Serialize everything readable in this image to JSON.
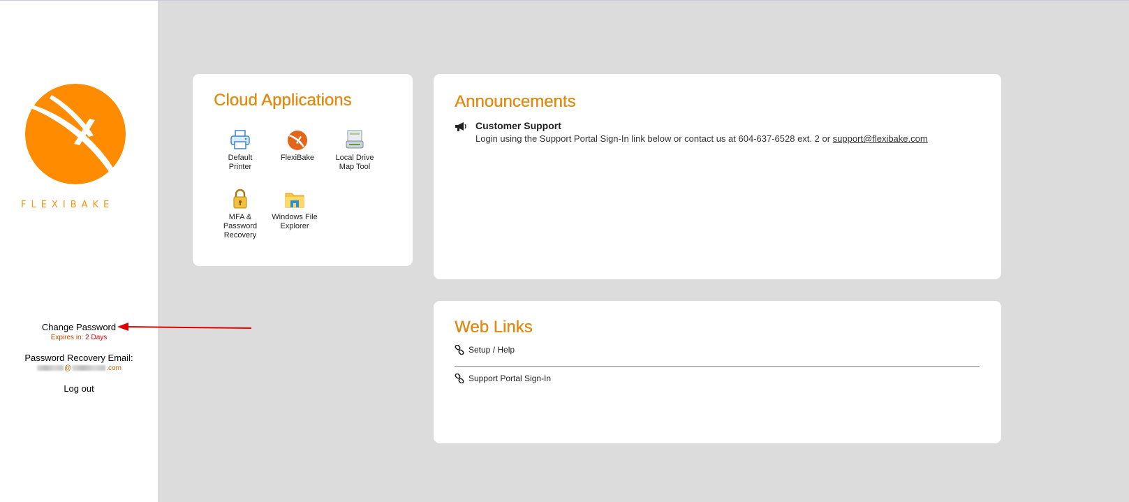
{
  "sidebar": {
    "brand_name": "FLEXIBAKE",
    "change_password": "Change Password",
    "expires_prefix": "Expires in:",
    "expires_value": "2 Days",
    "recovery_label": "Password Recovery Email:",
    "recovery_email_at": "@",
    "recovery_email_suffix": ".com",
    "logout": "Log out"
  },
  "cloud": {
    "title": "Cloud Applications",
    "apps": [
      {
        "label_1": "Default",
        "label_2": "Printer",
        "icon": "printer-icon"
      },
      {
        "label_1": "FlexiBake",
        "icon": "flexibake-icon"
      },
      {
        "label_1": "Local Drive",
        "label_2": "Map Tool",
        "icon": "drive-map-icon"
      },
      {
        "label_1": "MFA &",
        "label_2": "Password",
        "label_3": "Recovery",
        "icon": "lock-icon"
      },
      {
        "label_1": "Windows File",
        "label_2": "Explorer",
        "icon": "folder-icon"
      }
    ]
  },
  "announcements": {
    "title": "Announcements",
    "items": [
      {
        "title": "Customer Support",
        "body": "Login using the Support Portal Sign-In link below or contact us at 604-637-6528 ext. 2 or ",
        "link": "support@flexibake.com",
        "icon": "megaphone-icon"
      }
    ]
  },
  "weblinks": {
    "title": "Web Links",
    "links": [
      {
        "label": "Setup / Help",
        "icon": "link-icon"
      },
      {
        "label": "Support Portal Sign-In",
        "icon": "link-icon"
      }
    ]
  },
  "colors": {
    "accent": "#e08a12",
    "logo_orange": "#ff8c00",
    "page_bg": "#dcdcdc",
    "annotation_arrow": "#e00000"
  }
}
